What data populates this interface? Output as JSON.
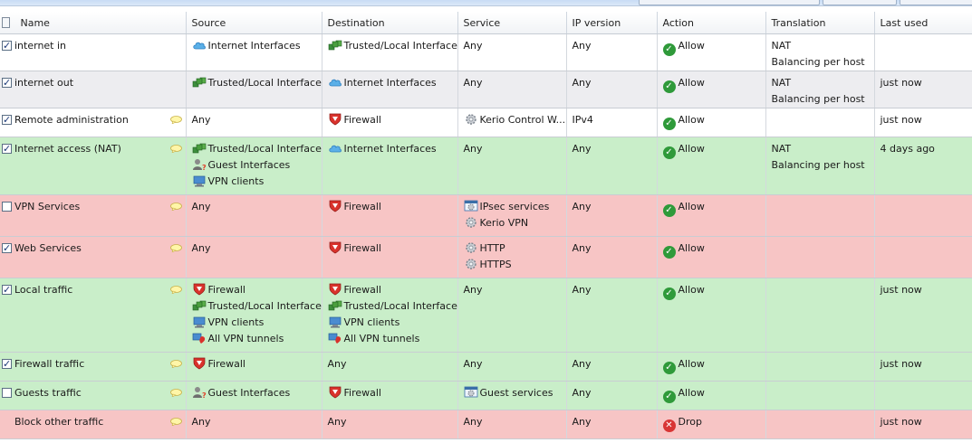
{
  "columns": {
    "name": "Name",
    "source": "Source",
    "destination": "Destination",
    "service": "Service",
    "ip_version": "IP version",
    "action": "Action",
    "translation": "Translation",
    "last_used": "Last used"
  },
  "rows": [
    {
      "name": "internet in",
      "checked": true,
      "comment": false,
      "color": "white",
      "source": [
        {
          "icon": "cloud-icon",
          "label": "Internet Interfaces"
        }
      ],
      "destination": [
        {
          "icon": "network-icon",
          "label": "Trusted/Local Interfaces"
        }
      ],
      "service": [
        {
          "icon": "",
          "label": "Any"
        }
      ],
      "ip_version": "Any",
      "action": "Allow",
      "translation": [
        "NAT",
        "Balancing per host"
      ],
      "last_used": ""
    },
    {
      "name": "internet out",
      "checked": true,
      "comment": false,
      "color": "gray",
      "source": [
        {
          "icon": "network-icon",
          "label": "Trusted/Local Interfaces"
        }
      ],
      "destination": [
        {
          "icon": "cloud-icon",
          "label": "Internet Interfaces"
        }
      ],
      "service": [
        {
          "icon": "",
          "label": "Any"
        }
      ],
      "ip_version": "Any",
      "action": "Allow",
      "translation": [
        "NAT",
        "Balancing per host"
      ],
      "last_used": "just now"
    },
    {
      "name": "Remote administration",
      "checked": true,
      "comment": true,
      "color": "white",
      "source": [
        {
          "icon": "",
          "label": "Any"
        }
      ],
      "destination": [
        {
          "icon": "firewall-icon",
          "label": "Firewall"
        }
      ],
      "service": [
        {
          "icon": "service-gear-icon",
          "label": "Kerio Control W..."
        }
      ],
      "ip_version": "IPv4",
      "action": "Allow",
      "translation": [],
      "last_used": "just now"
    },
    {
      "name": "Internet access (NAT)",
      "checked": true,
      "comment": true,
      "color": "green",
      "source": [
        {
          "icon": "network-icon",
          "label": "Trusted/Local Interfaces"
        },
        {
          "icon": "guest-user-icon",
          "label": "Guest Interfaces"
        },
        {
          "icon": "vpn-client-icon",
          "label": "VPN clients"
        }
      ],
      "destination": [
        {
          "icon": "cloud-icon",
          "label": "Internet Interfaces"
        }
      ],
      "service": [
        {
          "icon": "",
          "label": "Any"
        }
      ],
      "ip_version": "Any",
      "action": "Allow",
      "translation": [
        "NAT",
        "Balancing per host"
      ],
      "last_used": "4 days ago"
    },
    {
      "name": "VPN Services",
      "checked": false,
      "comment": true,
      "color": "red",
      "source": [
        {
          "icon": "",
          "label": "Any"
        }
      ],
      "destination": [
        {
          "icon": "firewall-icon",
          "label": "Firewall"
        }
      ],
      "service": [
        {
          "icon": "service-group-icon",
          "label": "IPsec services"
        },
        {
          "icon": "service-gear-icon",
          "label": "Kerio VPN"
        }
      ],
      "ip_version": "Any",
      "action": "Allow",
      "translation": [],
      "last_used": ""
    },
    {
      "name": "Web Services",
      "checked": true,
      "comment": true,
      "color": "red",
      "source": [
        {
          "icon": "",
          "label": "Any"
        }
      ],
      "destination": [
        {
          "icon": "firewall-icon",
          "label": "Firewall"
        }
      ],
      "service": [
        {
          "icon": "service-gear-icon",
          "label": "HTTP"
        },
        {
          "icon": "service-gear-icon",
          "label": "HTTPS"
        }
      ],
      "ip_version": "Any",
      "action": "Allow",
      "translation": [],
      "last_used": ""
    },
    {
      "name": "Local traffic",
      "checked": true,
      "comment": true,
      "color": "green",
      "source": [
        {
          "icon": "firewall-icon",
          "label": "Firewall"
        },
        {
          "icon": "network-icon",
          "label": "Trusted/Local Interfaces"
        },
        {
          "icon": "vpn-client-icon",
          "label": "VPN clients"
        },
        {
          "icon": "vpn-tunnel-icon",
          "label": "All VPN tunnels"
        }
      ],
      "destination": [
        {
          "icon": "firewall-icon",
          "label": "Firewall"
        },
        {
          "icon": "network-icon",
          "label": "Trusted/Local Interfaces"
        },
        {
          "icon": "vpn-client-icon",
          "label": "VPN clients"
        },
        {
          "icon": "vpn-tunnel-icon",
          "label": "All VPN tunnels"
        }
      ],
      "service": [
        {
          "icon": "",
          "label": "Any"
        }
      ],
      "ip_version": "Any",
      "action": "Allow",
      "translation": [],
      "last_used": "just now"
    },
    {
      "name": "Firewall traffic",
      "checked": true,
      "comment": true,
      "color": "green",
      "source": [
        {
          "icon": "firewall-icon",
          "label": "Firewall"
        }
      ],
      "destination": [
        {
          "icon": "",
          "label": "Any"
        }
      ],
      "service": [
        {
          "icon": "",
          "label": "Any"
        }
      ],
      "ip_version": "Any",
      "action": "Allow",
      "translation": [],
      "last_used": "just now"
    },
    {
      "name": "Guests traffic",
      "checked": false,
      "comment": true,
      "color": "green",
      "source": [
        {
          "icon": "guest-user-icon",
          "label": "Guest Interfaces"
        }
      ],
      "destination": [
        {
          "icon": "firewall-icon",
          "label": "Firewall"
        }
      ],
      "service": [
        {
          "icon": "service-group-icon",
          "label": "Guest services"
        }
      ],
      "ip_version": "Any",
      "action": "Allow",
      "translation": [],
      "last_used": ""
    },
    {
      "name": "Block other traffic",
      "checked": null,
      "comment": true,
      "color": "red",
      "source": [
        {
          "icon": "",
          "label": "Any"
        }
      ],
      "destination": [
        {
          "icon": "",
          "label": "Any"
        }
      ],
      "service": [
        {
          "icon": "",
          "label": "Any"
        }
      ],
      "ip_version": "Any",
      "action": "Drop",
      "translation": [],
      "last_used": "just now"
    }
  ]
}
